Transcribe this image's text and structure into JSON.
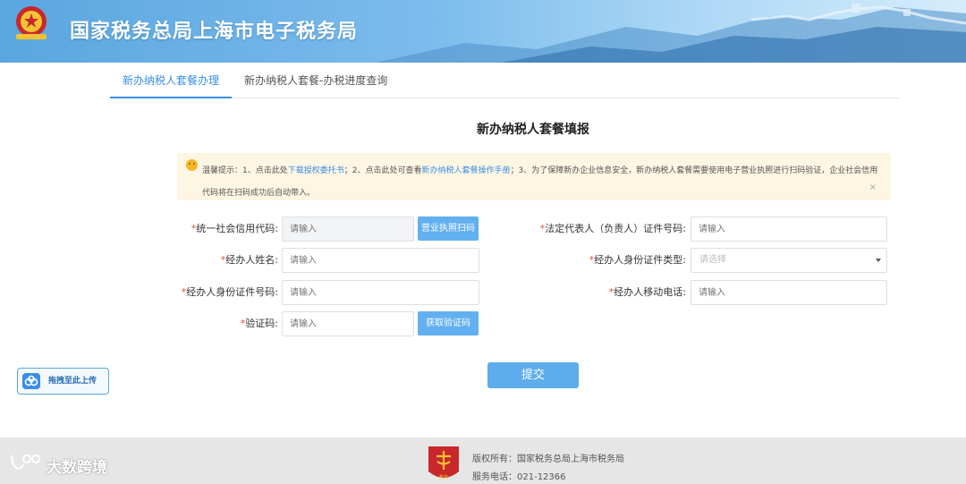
{
  "header": {
    "title": "国家税务总局上海市电子税务局",
    "emblem_text": "中国税务"
  },
  "tabs": [
    {
      "label": "新办纳税人套餐办理",
      "active": true
    },
    {
      "label": "新办纳税人套餐-办税进度查询",
      "active": false
    }
  ],
  "form": {
    "title": "新办纳税人套餐填报",
    "notice": {
      "prefix": "温馨提示：1、点击此处",
      "link1": "下载授权委托书",
      "mid": "；2、点击此处可查看",
      "link2": "新办纳税人套餐操作手册",
      "suffix": "；3、为了保障新办企业信息安全，新办纳税人套餐需要使用电子营业执照进行扫码验证，企业社会信用代码将在扫码成功后自动带入。",
      "close": "×"
    },
    "fields": {
      "credit_code": {
        "label": "统一社会信用代码:",
        "placeholder": "请输入",
        "button": "营业执照扫码"
      },
      "agent_name": {
        "label": "经办人姓名:",
        "placeholder": "请输入"
      },
      "agent_id_no": {
        "label": "经办人身份证件号码:",
        "placeholder": "请输入"
      },
      "verify_code": {
        "label": "验证码:",
        "placeholder": "请输入",
        "button": "获取验证码"
      },
      "legal_rep_id": {
        "label": "法定代表人（负责人）证件号码:",
        "placeholder": "请输入"
      },
      "agent_id_type": {
        "label": "经办人身份证件类型:",
        "placeholder": "请选择"
      },
      "agent_phone": {
        "label": "经办人移动电话:",
        "placeholder": "请输入"
      }
    },
    "required_mark": "*",
    "submit": "提交"
  },
  "upload": {
    "label": "拖拽至此上传"
  },
  "footer": {
    "copyright": "版权所有：国家税务总局上海市税务局",
    "phone": "服务电话：021-12366",
    "logo_text": "税务"
  },
  "watermark": {
    "text": "大数跨境"
  },
  "colors": {
    "accent": "#3a8ee6",
    "button": "#5dacec",
    "required": "#e64b3b",
    "notice_bg": "#fdf6e3"
  }
}
